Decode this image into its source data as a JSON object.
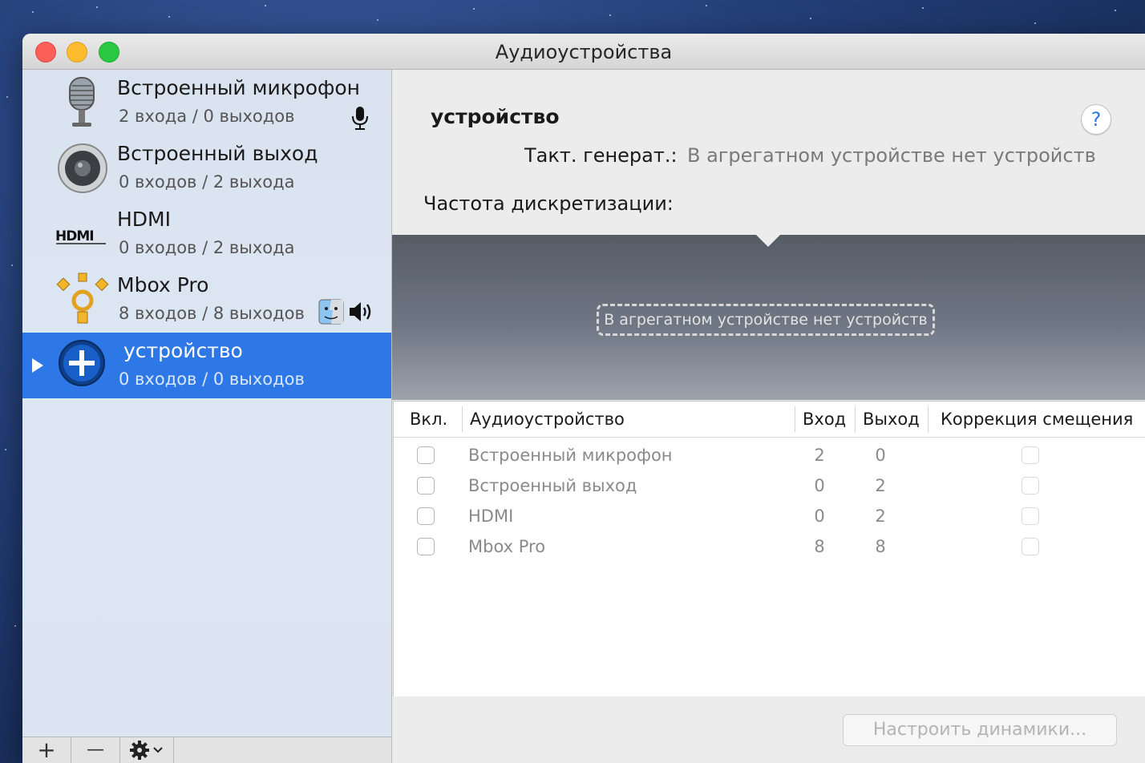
{
  "window": {
    "title": "Аудиоустройства"
  },
  "devices": [
    {
      "name": "Встроенный микрофон",
      "io": "2 входа / 0 выходов",
      "icon": "microphone-icon",
      "status_icon": "mic-input-icon"
    },
    {
      "name": "Встроенный выход",
      "io": "0 входов / 2 выхода",
      "icon": "speaker-icon"
    },
    {
      "name": "HDMI",
      "io": "0 входов / 2 выхода",
      "icon": "hdmi-icon"
    },
    {
      "name": "Mbox Pro",
      "io": "8 входов / 8 выходов",
      "icon": "firewire-icon",
      "status_icons": [
        "finder-icon",
        "speaker-output-icon"
      ]
    },
    {
      "name": "устройство",
      "io": "0 входов / 0 выходов",
      "icon": "aggregate-plus-icon",
      "selected": true
    }
  ],
  "sidebar_tools": {
    "add": "+",
    "remove": "—"
  },
  "detail": {
    "device_name": "устройство",
    "help": "?",
    "clock_label": "Такт. генерат.:",
    "clock_value": "В агрегатном устройстве нет устройств",
    "rate_label": "Частота дискретизации:"
  },
  "aggregate": {
    "empty_message": "В агрегатном устройстве нет устройств"
  },
  "table": {
    "headers": {
      "on": "Вкл.",
      "device": "Аудиоустройство",
      "in": "Вход",
      "out": "Выход",
      "drift": "Коррекция смещения"
    },
    "rows": [
      {
        "name": "Встроенный микрофон",
        "in": "2",
        "out": "0"
      },
      {
        "name": "Встроенный выход",
        "in": "0",
        "out": "2"
      },
      {
        "name": "HDMI",
        "in": "0",
        "out": "2"
      },
      {
        "name": "Mbox Pro",
        "in": "8",
        "out": "8"
      }
    ]
  },
  "footer": {
    "configure_speakers": "Настроить динамики..."
  },
  "colors": {
    "selection": "#2e77e6",
    "sidebar": "#dbe4f1"
  }
}
